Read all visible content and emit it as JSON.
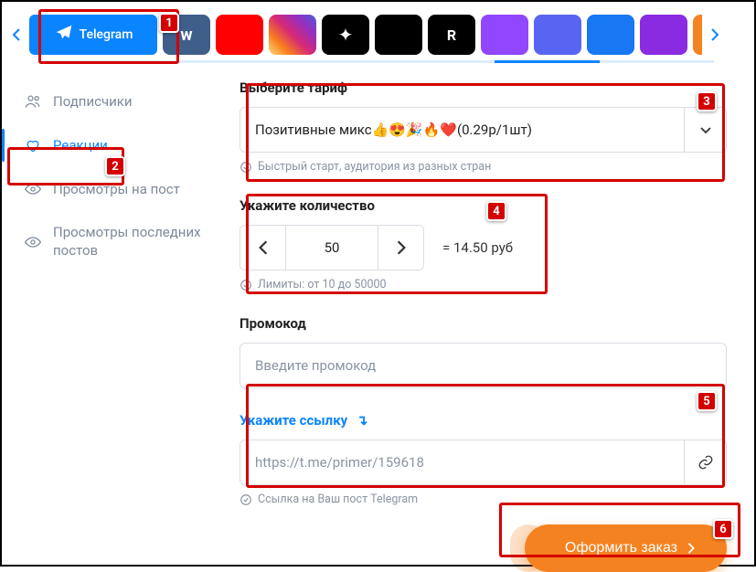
{
  "platforms": {
    "active_label": "Telegram"
  },
  "sidebar": {
    "items": [
      {
        "label": "Подписчики"
      },
      {
        "label": "Реакции"
      },
      {
        "label": "Просмотры на пост"
      },
      {
        "label": "Просмотры последних постов"
      }
    ]
  },
  "tariff": {
    "label": "Выберите тариф",
    "value_prefix": "Позитивные микс ",
    "value_suffix": " (0.29р/1шт)",
    "hint": "Быстрый старт, аудитория из разных стран"
  },
  "quantity": {
    "label": "Укажите количество",
    "value": "50",
    "price": "= 14.50 руб",
    "hint": "Лимиты: от 10 до 50000"
  },
  "promo": {
    "label": "Промокод",
    "placeholder": "Введите промокод"
  },
  "link": {
    "label": "Укажите ссылку",
    "placeholder": "https://t.me/primer/159618",
    "hint": "Ссылка на Ваш пост Telegram"
  },
  "submit": {
    "label": "Оформить заказ"
  },
  "annotations": {
    "n1": "1",
    "n2": "2",
    "n3": "3",
    "n4": "4",
    "n5": "5",
    "n6": "6"
  }
}
